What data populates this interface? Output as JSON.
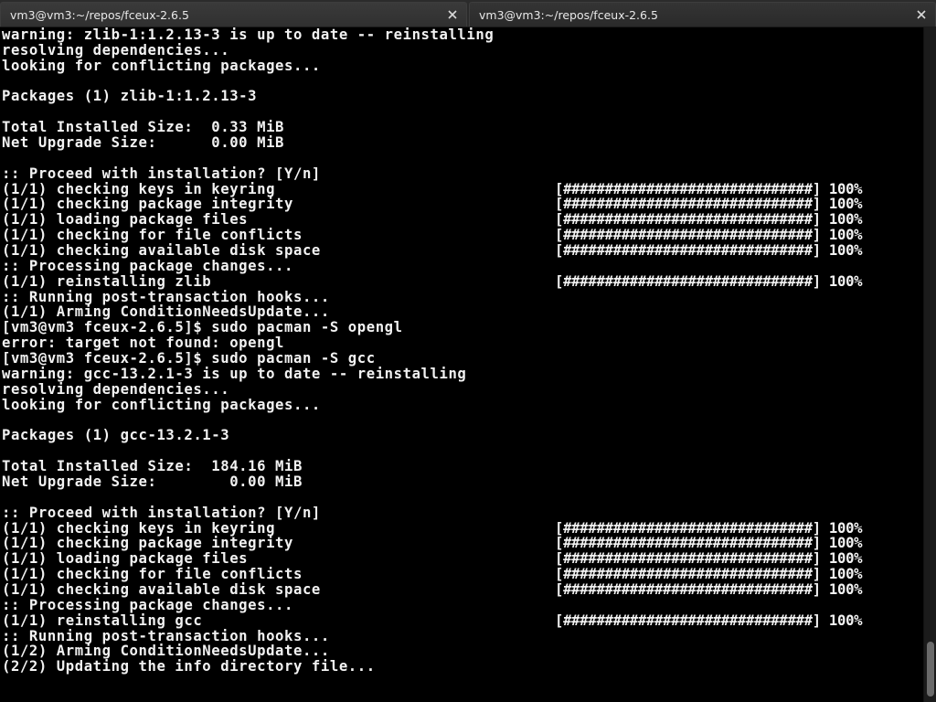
{
  "tabs": [
    {
      "title": "vm3@vm3:~/repos/fceux-2.6.5"
    },
    {
      "title": "vm3@vm3:~/repos/fceux-2.6.5"
    }
  ],
  "colors": {
    "background": "#000000",
    "text": "#f2f2f2",
    "tabbar": "#2b2b2b"
  },
  "terminal": {
    "lines": [
      "warning: zlib-1:1.2.13-3 is up to date -- reinstalling",
      "resolving dependencies...",
      "looking for conflicting packages...",
      "",
      "Packages (1) zlib-1:1.2.13-3",
      "",
      "Total Installed Size:  0.33 MiB",
      "Net Upgrade Size:      0.00 MiB",
      "",
      ":: Proceed with installation? [Y/n]",
      "(1/1) checking keys in keyring",
      "(1/1) checking package integrity",
      "(1/1) loading package files",
      "(1/1) checking for file conflicts",
      "(1/1) checking available disk space",
      ":: Processing package changes...",
      "(1/1) reinstalling zlib",
      ":: Running post-transaction hooks...",
      "(1/1) Arming ConditionNeedsUpdate...",
      "[vm3@vm3 fceux-2.6.5]$ sudo pacman -S opengl",
      "error: target not found: opengl",
      "[vm3@vm3 fceux-2.6.5]$ sudo pacman -S gcc",
      "warning: gcc-13.2.1-3 is up to date -- reinstalling",
      "resolving dependencies...",
      "looking for conflicting packages...",
      "",
      "Packages (1) gcc-13.2.1-3",
      "",
      "Total Installed Size:  184.16 MiB",
      "Net Upgrade Size:        0.00 MiB",
      "",
      ":: Proceed with installation? [Y/n]",
      "(1/1) checking keys in keyring",
      "(1/1) checking package integrity",
      "(1/1) loading package files",
      "(1/1) checking for file conflicts",
      "(1/1) checking available disk space",
      ":: Processing package changes...",
      "(1/1) reinstalling gcc",
      ":: Running post-transaction hooks...",
      "(1/2) Arming ConditionNeedsUpdate...",
      "(2/2) Updating the info directory file..."
    ],
    "progress": [
      {
        "line": 10,
        "text": "[##############################] 100%"
      },
      {
        "line": 11,
        "text": "[##############################] 100%"
      },
      {
        "line": 12,
        "text": "[##############################] 100%"
      },
      {
        "line": 13,
        "text": "[##############################] 100%"
      },
      {
        "line": 14,
        "text": "[##############################] 100%"
      },
      {
        "line": 16,
        "text": "[##############################] 100%"
      },
      {
        "line": 32,
        "text": "[##############################] 100%"
      },
      {
        "line": 33,
        "text": "[##############################] 100%"
      },
      {
        "line": 34,
        "text": "[##############################] 100%"
      },
      {
        "line": 35,
        "text": "[##############################] 100%"
      },
      {
        "line": 36,
        "text": "[##############################] 100%"
      },
      {
        "line": 38,
        "text": "[##############################] 100%"
      }
    ]
  }
}
